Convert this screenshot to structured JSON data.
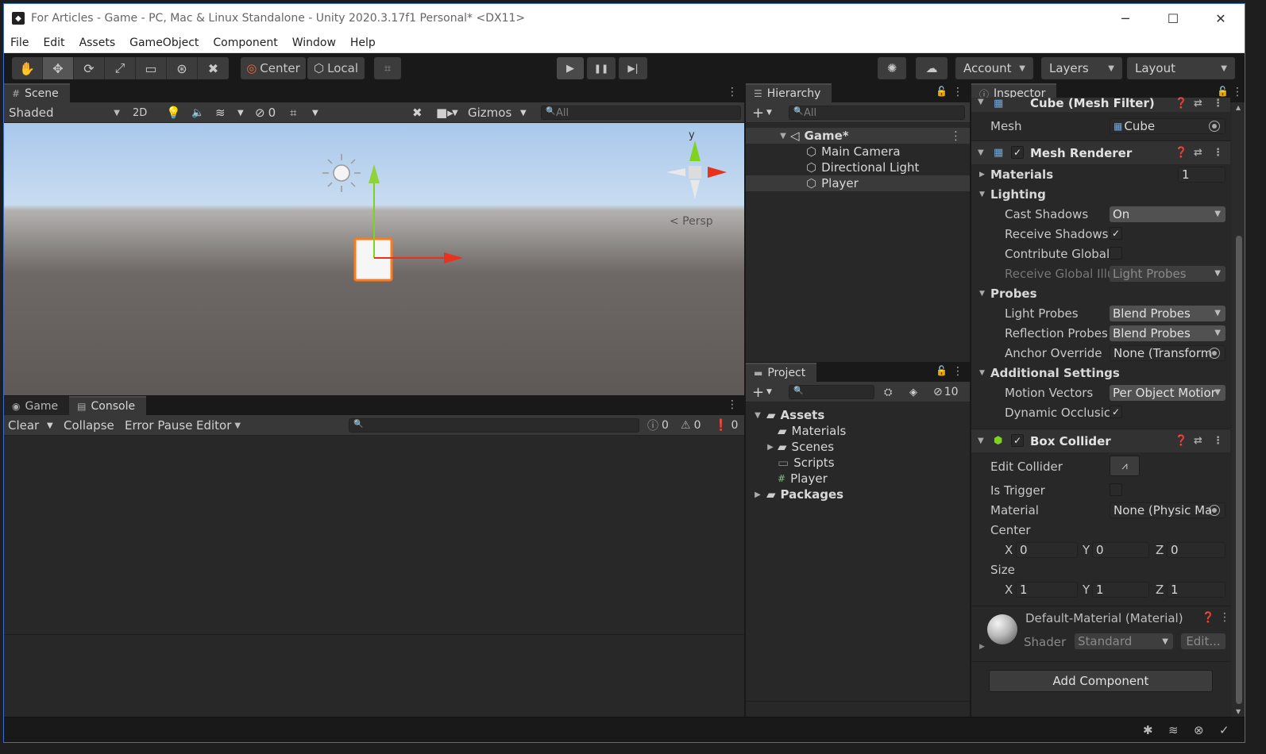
{
  "window": {
    "title": "For Articles - Game - PC, Mac & Linux Standalone - Unity 2020.3.17f1 Personal* <DX11>",
    "app_icon": "unity-icon",
    "controls": {
      "minimize": "─",
      "maximize": "☐",
      "close": "✕"
    }
  },
  "menu": [
    "File",
    "Edit",
    "Assets",
    "GameObject",
    "Component",
    "Window",
    "Help"
  ],
  "toolbar": {
    "tools": [
      "✋",
      "✥",
      "⟳",
      "⤢",
      "▭",
      "⊛",
      "✖"
    ],
    "pivot": "Center",
    "space": "Local",
    "grid_snap": "⌗",
    "play": "▶",
    "pause": "❚❚",
    "step": "▶|",
    "account": "Account",
    "layers": "Layers",
    "layout": "Layout"
  },
  "scene": {
    "tab": "Scene",
    "draw_mode": "Shaded",
    "mode_2d": "2D",
    "hidden_count": "0",
    "gizmos": "Gizmos",
    "search_placeholder": "All",
    "persp": "< Persp",
    "axis_y": "y"
  },
  "console": {
    "tabs": [
      "Game",
      "Console"
    ],
    "clear": "Clear",
    "collapse": "Collapse",
    "error_pause": "Error Pause",
    "editor": "Editor",
    "counts": {
      "info": "0",
      "warn": "0",
      "error": "0"
    }
  },
  "hierarchy": {
    "tab": "Hierarchy",
    "search_placeholder": "All",
    "scene_name": "Game*",
    "items": [
      "Main Camera",
      "Directional Light",
      "Player"
    ]
  },
  "project": {
    "tab": "Project",
    "hidden_count": "10",
    "assets": "Assets",
    "folders": [
      "Materials",
      "Scenes",
      "Scripts"
    ],
    "script": "Player",
    "packages": "Packages"
  },
  "inspector": {
    "tab": "Inspector",
    "mesh_filter": {
      "title": "Cube (Mesh Filter)",
      "mesh_label": "Mesh",
      "mesh_value": "Cube"
    },
    "mesh_renderer": {
      "title": "Mesh Renderer",
      "materials_label": "Materials",
      "materials_count": "1",
      "lighting": "Lighting",
      "cast_shadows_label": "Cast Shadows",
      "cast_shadows_value": "On",
      "receive_shadows_label": "Receive Shadows",
      "contribute_gi_label": "Contribute Global",
      "receive_gi_label": "Receive Global Illu",
      "receive_gi_value": "Light Probes",
      "probes": "Probes",
      "light_probes_label": "Light Probes",
      "light_probes_value": "Blend Probes",
      "reflection_probes_label": "Reflection Probes",
      "reflection_probes_value": "Blend Probes",
      "anchor_override_label": "Anchor Override",
      "anchor_override_value": "None (Transform",
      "additional": "Additional Settings",
      "motion_vectors_label": "Motion Vectors",
      "motion_vectors_value": "Per Object Motior",
      "dynamic_occlusion_label": "Dynamic Occlusic"
    },
    "box_collider": {
      "title": "Box Collider",
      "edit_collider_label": "Edit Collider",
      "is_trigger_label": "Is Trigger",
      "material_label": "Material",
      "material_value": "None (Physic Ma",
      "center_label": "Center",
      "center": {
        "x": "0",
        "y": "0",
        "z": "0"
      },
      "size_label": "Size",
      "size": {
        "x": "1",
        "y": "1",
        "z": "1"
      },
      "axis": {
        "x": "X",
        "y": "Y",
        "z": "Z"
      }
    },
    "material": {
      "title": "Default-Material (Material)",
      "shader_label": "Shader",
      "shader_value": "Standard",
      "edit": "Edit..."
    },
    "add_component": "Add Component"
  }
}
